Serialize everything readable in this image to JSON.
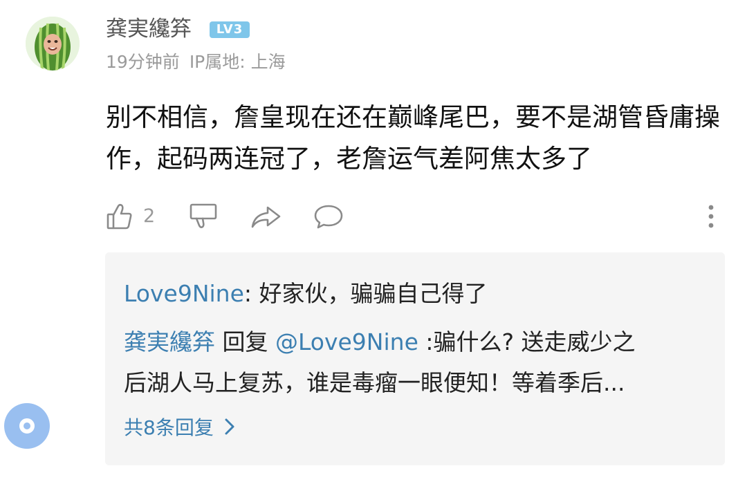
{
  "comment": {
    "username": "龚実纔笲",
    "level": "LV3",
    "time": "19分钟前",
    "ip_location": "IP属地: 上海",
    "text": "别不相信，詹皇现在还在巅峰尾巴，要不是湖管昏庸操作，起码两连冠了，老詹运气差阿焦太多了",
    "like_count": "2"
  },
  "replies": {
    "first": {
      "author": "Love9Nine",
      "colon": ": ",
      "text": "好家伙，骗骗自己得了"
    },
    "second": {
      "author": "龚実纔笲",
      "reply_word": " 回复 ",
      "target": "@Love9Nine",
      "text_line1": " :骗什么? 送走威少之",
      "text_line2": "后湖人马上复苏，谁是毒瘤一眼便知！等着季后..."
    },
    "total_label": "共8条回复"
  },
  "icons": {
    "like": "thumbs-up-icon",
    "dislike": "thumbs-down-icon",
    "share": "share-icon",
    "reply": "comment-bubble-icon",
    "more": "more-vertical-icon",
    "expand": "chevron-right-icon",
    "float": "floating-ball-icon"
  },
  "colors": {
    "link_blue": "#3c7fb1",
    "badge_blue": "#7fc6ea",
    "meta_gray": "#9a9a9a",
    "reply_bg": "#f5f5f5",
    "float_ball": "#99bff0"
  }
}
